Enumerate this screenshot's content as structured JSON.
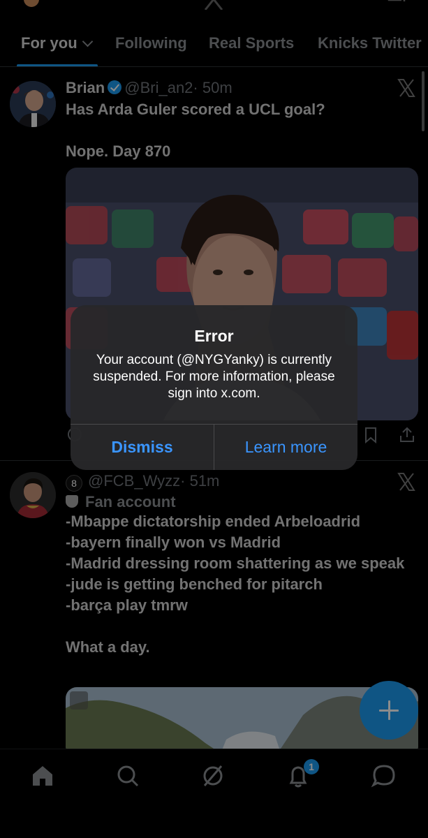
{
  "header": {
    "logo_icon": "x-logo-icon",
    "right_icon": "add-account-icon"
  },
  "tabs": [
    {
      "label": "For you",
      "active": true
    },
    {
      "label": "Following",
      "active": false
    },
    {
      "label": "Real Sports",
      "active": false
    },
    {
      "label": "Knicks Twitter",
      "active": false
    }
  ],
  "tweets": [
    {
      "name": "Brian",
      "verified": true,
      "handle": "@Bri_an2",
      "time": "· 50m",
      "text": "Has Arda Guler scored a UCL goal?\n\nNope. Day 870",
      "media": "photo"
    },
    {
      "name_emoji": "8",
      "handle": "@FCB_Wyzz",
      "time": "· 51m",
      "fan_label": "Fan account",
      "text": "-Mbappe dictatorship ended Arbeloadrid\n-bayern finally won vs Madrid\n-Madrid dressing room shattering as we speak\n-jude is getting benched for pitarch\n-barça play tmrw\n\nWhat a day.",
      "media": "photo"
    }
  ],
  "alert": {
    "title": "Error",
    "message": "Your account (@NYGYanky) is currently suspended. For more information, please sign into x.com.",
    "dismiss_label": "Dismiss",
    "learn_more_label": "Learn more"
  },
  "bottom_nav": {
    "items": [
      "home-icon",
      "search-icon",
      "grok-icon",
      "notifications-icon",
      "messages-icon"
    ],
    "notification_count": "1"
  },
  "colors": {
    "accent": "#1d9bf0",
    "alert_button": "#3a95ff",
    "background": "#000000"
  }
}
